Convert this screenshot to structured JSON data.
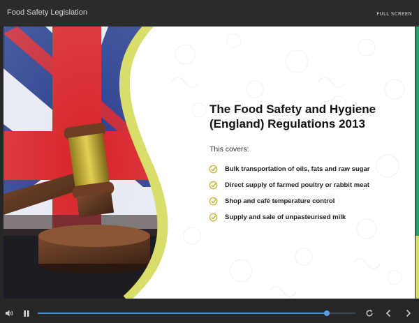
{
  "header": {
    "title": "Food Safety Legislation",
    "fullscreen_label": "FULL SCREEN"
  },
  "slide": {
    "heading": "The Food Safety and Hygiene (England) Regulations 2013",
    "intro": "This covers:",
    "items": [
      "Bulk transportation of oils, fats and raw sugar",
      "Direct supply of farmed poultry or rabbit meat",
      "Shop and café temperature control",
      "Supply and sale of unpasteurised milk"
    ]
  },
  "player": {
    "progress_fraction": 0.91
  },
  "colors": {
    "accent_green": "#2e9e6a",
    "accent_yellow": "#d9dd6a",
    "check_color": "#c6b33a",
    "progress_blue": "#4a90d9"
  },
  "icons": [
    "volume-icon",
    "pause-icon",
    "replay-icon",
    "previous-icon",
    "next-icon",
    "check-icon"
  ]
}
